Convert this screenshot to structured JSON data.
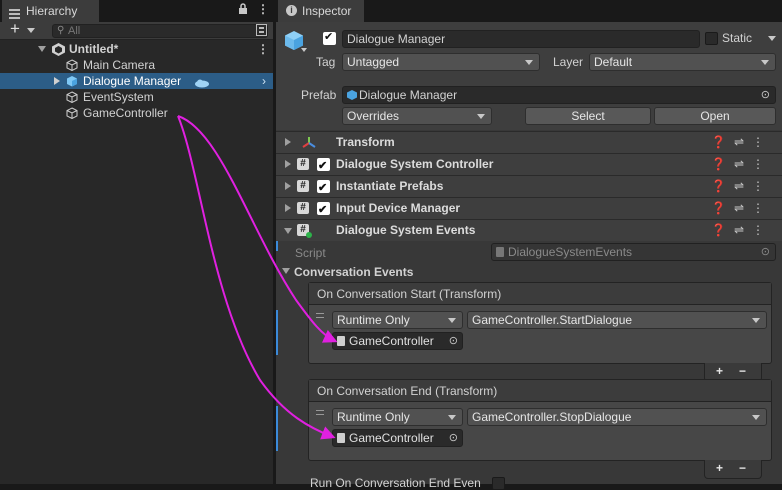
{
  "hierarchy": {
    "tab_label": "Hierarchy",
    "add_label": "+",
    "search_placeholder": "All",
    "scene_name": "Untitled*",
    "items": [
      {
        "label": "Main Camera"
      },
      {
        "label": "Dialogue Manager"
      },
      {
        "label": "EventSystem"
      },
      {
        "label": "GameController"
      }
    ]
  },
  "inspector": {
    "tab_label": "Inspector",
    "object_name": "Dialogue Manager",
    "static_label": "Static",
    "tag_label": "Tag",
    "tag_value": "Untagged",
    "layer_label": "Layer",
    "layer_value": "Default",
    "prefab_label": "Prefab",
    "prefab_value": "Dialogue Manager",
    "overrides_label": "Overrides",
    "select_label": "Select",
    "open_label": "Open",
    "components": [
      {
        "label": "Transform"
      },
      {
        "label": "Dialogue System Controller"
      },
      {
        "label": "Instantiate Prefabs"
      },
      {
        "label": "Input Device Manager"
      },
      {
        "label": "Dialogue System Events"
      }
    ],
    "script_label": "Script",
    "script_value": "DialogueSystemEvents",
    "section_label": "Conversation Events",
    "events": [
      {
        "header": "On Conversation Start (Transform)",
        "mode": "Runtime Only",
        "function": "GameController.StartDialogue",
        "target": "GameController"
      },
      {
        "header": "On Conversation End (Transform)",
        "mode": "Runtime Only",
        "function": "GameController.StopDialogue",
        "target": "GameController"
      }
    ],
    "bottom_label": "Run On Conversation End Even"
  },
  "colors": {
    "selection": "#2c5d87",
    "accent_blue": "#3b8ad9",
    "arrow_magenta": "#e020e0",
    "prefab_blue": "#4aa3e0"
  }
}
